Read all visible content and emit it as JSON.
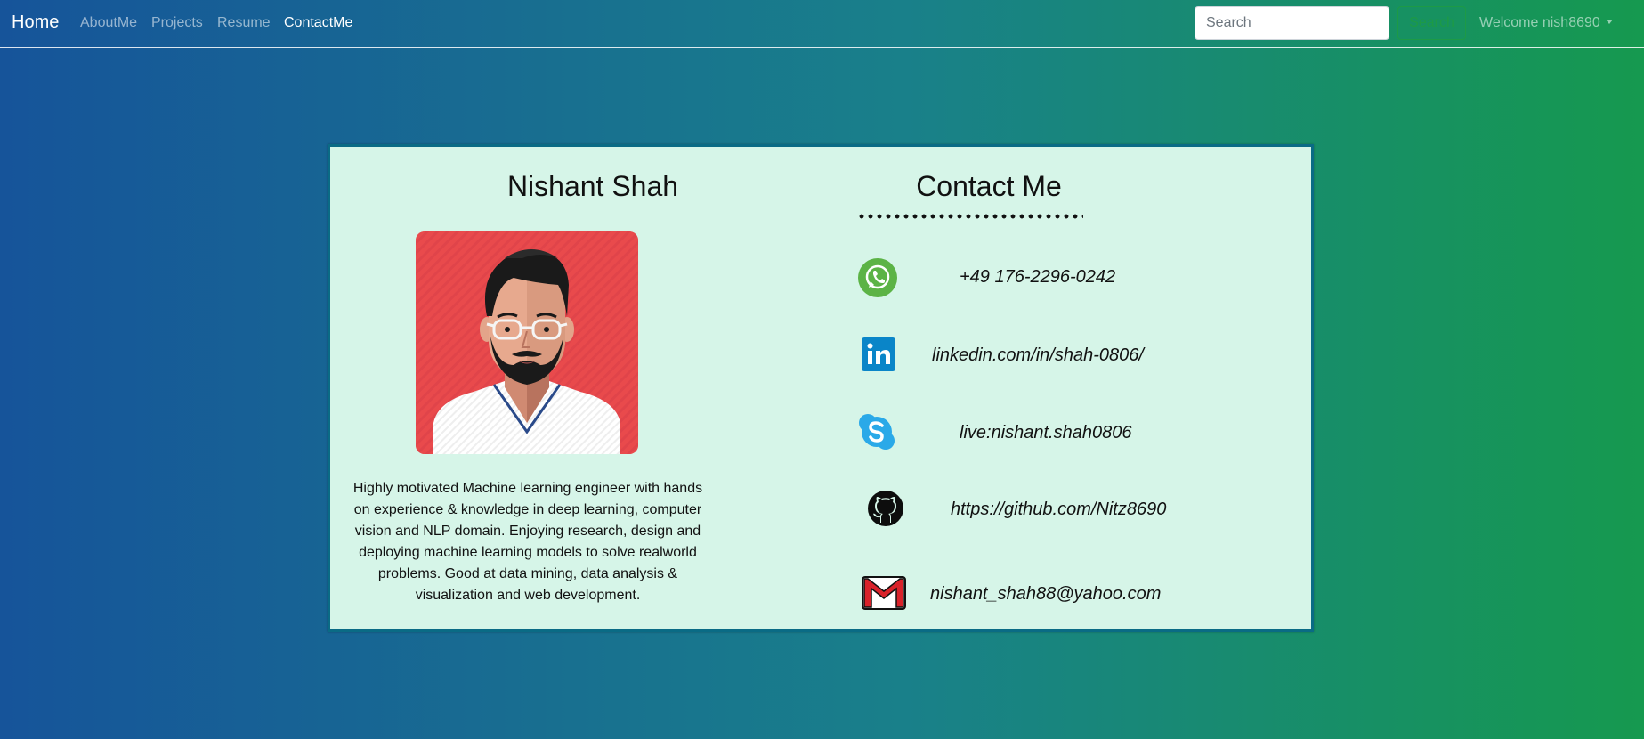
{
  "navbar": {
    "brand": "Home",
    "links": [
      "AboutMe",
      "Projects",
      "Resume",
      "ContactMe"
    ],
    "search_placeholder": "Search",
    "search_button": "Search",
    "welcome": "Welcome nish8690"
  },
  "profile": {
    "name": "Nishant Shah",
    "avatar_icon": "avatar-illustration",
    "bio": "Highly motivated Machine learning engineer with hands on experience & knowledge in deep learning, computer vision and NLP domain. Enjoying research, design and deploying machine learning models to solve realworld problems. Good at data mining, data analysis & visualization and web development."
  },
  "contact": {
    "title": "Contact Me",
    "items": [
      {
        "icon": "whatsapp-icon",
        "text": "+49 176-2296-0242"
      },
      {
        "icon": "linkedin-icon",
        "text": "linkedin.com/in/shah-0806/"
      },
      {
        "icon": "skype-icon",
        "text": "live:nishant.shah0806"
      },
      {
        "icon": "github-icon",
        "text": "https://github.com/Nitz8690"
      },
      {
        "icon": "gmail-icon",
        "text": "nishant_shah88@yahoo.com"
      }
    ]
  },
  "colors": {
    "card_bg": "#d6f5e8",
    "card_border": "#0a6b85",
    "whatsapp": "#5cb346",
    "linkedin": "#0a85c8",
    "skype": "#2aa9e8",
    "avatar_bg": "#e94a4c",
    "search_button": "#1d9a46"
  }
}
